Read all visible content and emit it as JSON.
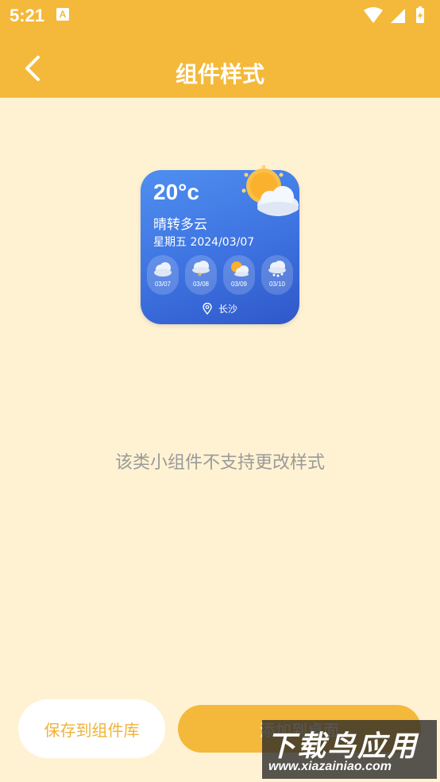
{
  "status_bar": {
    "time": "5:21",
    "app_indicator": "A",
    "icons": [
      "wifi-icon",
      "signal-icon",
      "battery-icon"
    ]
  },
  "app_bar": {
    "title": "组件样式",
    "back_icon": "chevron-left-icon"
  },
  "widget": {
    "temperature": "20°c",
    "condition": "晴转多云",
    "date": "星期五 2024/03/07",
    "main_icon": "sun-cloud-icon",
    "forecast": [
      {
        "date": "03/07",
        "icon": "cloud-icon"
      },
      {
        "date": "03/08",
        "icon": "thunder-cloud-icon"
      },
      {
        "date": "03/09",
        "icon": "sun-cloud-icon"
      },
      {
        "date": "03/10",
        "icon": "snow-cloud-icon"
      }
    ],
    "location": "长沙",
    "location_icon": "location-pin-icon"
  },
  "notice": "该类小组件不支持更改样式",
  "buttons": {
    "save": "保存到组件库",
    "add": "添加到桌面"
  },
  "watermark": {
    "line1": "下载鸟应用",
    "line2": "www.xiazainiao.com"
  },
  "colors": {
    "accent": "#f4b93a",
    "background": "#fff2d3",
    "widget_blue": "#3d72e0"
  }
}
